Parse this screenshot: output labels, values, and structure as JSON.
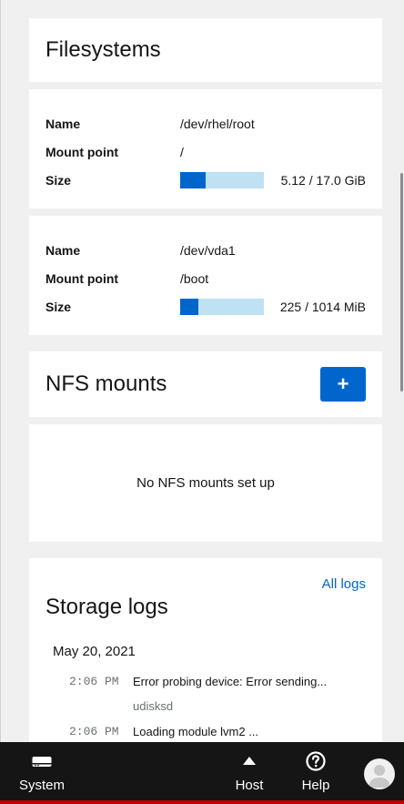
{
  "filesystems": {
    "title": "Filesystems",
    "entries": [
      {
        "name_label": "Name",
        "name": "/dev/rhel/root",
        "mount_label": "Mount point",
        "mount": "/",
        "size_label": "Size",
        "size_text": "5.12 / 17.0 GiB",
        "usage_fraction": 0.3
      },
      {
        "name_label": "Name",
        "name": "/dev/vda1",
        "mount_label": "Mount point",
        "mount": "/boot",
        "size_label": "Size",
        "size_text": "225 / 1014 MiB",
        "usage_fraction": 0.22
      }
    ]
  },
  "nfs": {
    "title": "NFS mounts",
    "add_label": "+",
    "empty_text": "No NFS mounts set up"
  },
  "logs": {
    "title": "Storage logs",
    "all_logs": "All logs",
    "date": "May 20, 2021",
    "entries": [
      {
        "time": "2:06 PM",
        "message": "Error probing device: Error sending...",
        "source": "udisksd"
      },
      {
        "time": "2:06 PM",
        "message": "Loading module lvm2 ...",
        "source": ""
      }
    ]
  },
  "nav": {
    "system_label": "System",
    "host_label": "Host",
    "help_label": "Help"
  },
  "colors": {
    "accent": "#0066cc",
    "bar_bg": "#bee1f4",
    "nav_bg": "#151515"
  }
}
